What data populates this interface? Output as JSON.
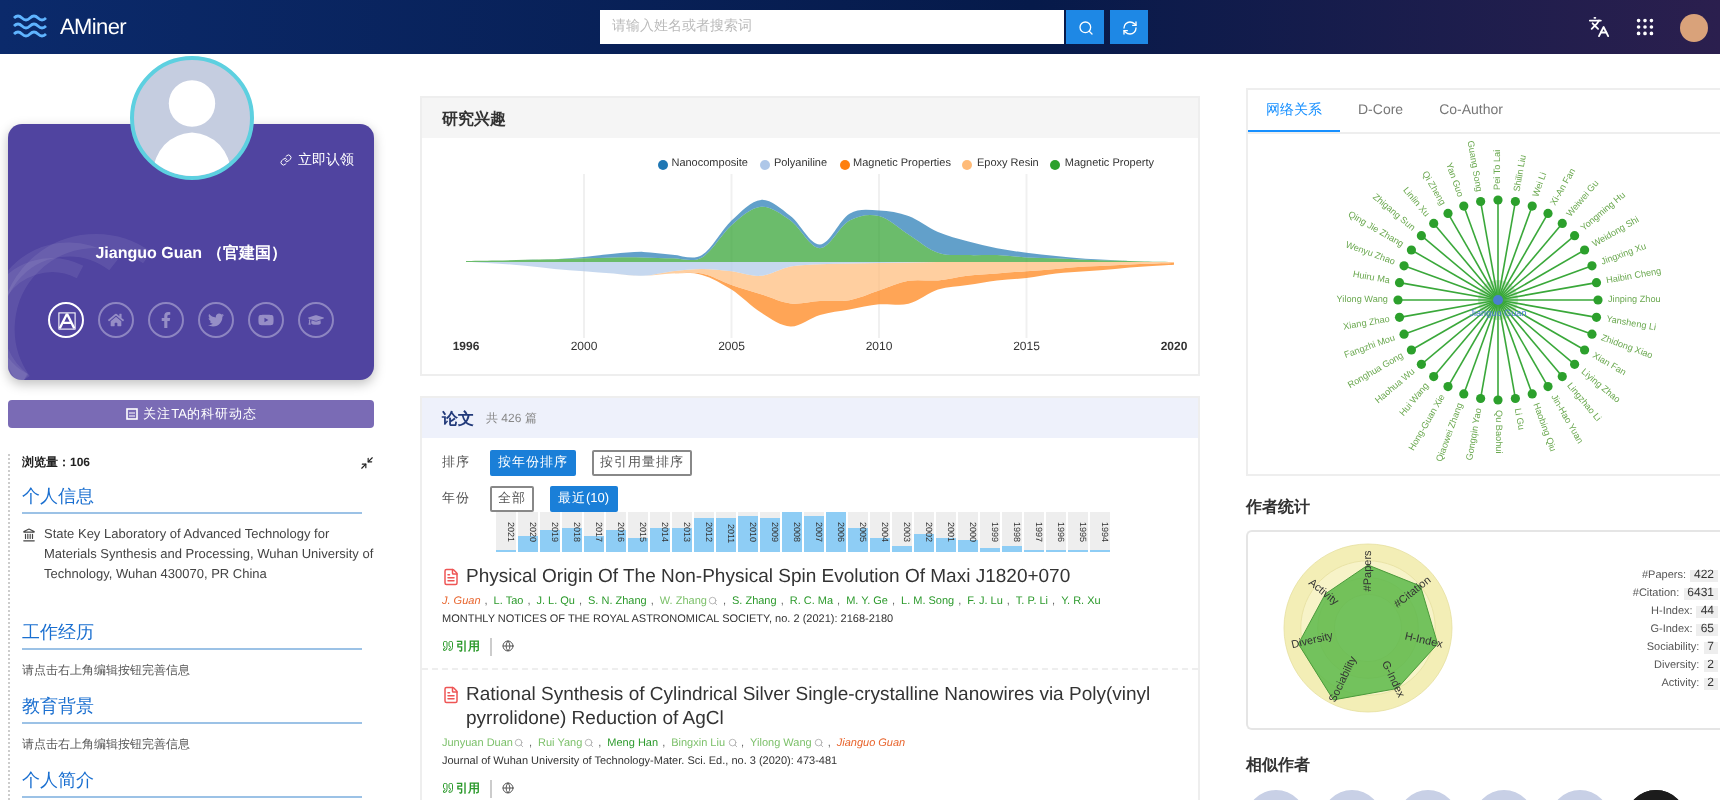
{
  "topbar": {
    "logo": "AMiner",
    "search": {
      "placeholder": "请输入姓名或者搜索词"
    }
  },
  "profile": {
    "claim": "立即认领",
    "name": "Jianguo Guan （官建国）",
    "social_links": [
      {
        "kind": "aminer",
        "selected": true
      },
      {
        "kind": "home",
        "selected": false
      },
      {
        "kind": "facebook",
        "selected": false
      },
      {
        "kind": "twitter",
        "selected": false
      },
      {
        "kind": "youtube",
        "selected": false
      },
      {
        "kind": "scholar",
        "selected": false
      }
    ],
    "follow_button": "关注TA的科研动态",
    "views": "浏览量：106",
    "sections": [
      {
        "title": "个人信息",
        "kind": "institution",
        "text": "State Key Laboratory of Advanced Technology for Materials Synthesis and Processing, Wuhan University of Technology, Wuhan 430070, PR China"
      },
      {
        "title": "工作经历",
        "kind": "hint",
        "text": "请点击右上角编辑按钮完善信息"
      },
      {
        "title": "教育背景",
        "kind": "hint",
        "text": "请点击右上角编辑按钮完善信息"
      },
      {
        "title": "个人简介",
        "kind": "empty"
      }
    ]
  },
  "interests": {
    "title": "研究兴趣",
    "legend": [
      {
        "label": "Nanocomposite",
        "color": "#1f77b4"
      },
      {
        "label": "Polyaniline",
        "color": "#aec7e8"
      },
      {
        "label": "Magnetic Properties",
        "color": "#ff7f0e"
      },
      {
        "label": "Epoxy Resin",
        "color": "#ffbb78"
      },
      {
        "label": "Magnetic Property",
        "color": "#2ca02c"
      }
    ],
    "axis": [
      "1996",
      "2000",
      "2005",
      "2010",
      "2015",
      "2020"
    ]
  },
  "papers": {
    "title": "论文",
    "count": "共 426 篇",
    "sort_label": "排序",
    "sort_options": [
      {
        "label": "按年份排序",
        "selected": true
      },
      {
        "label": "按引用量排序",
        "selected": false
      }
    ],
    "year_label": "年份",
    "year_options": [
      {
        "label": "全部",
        "selected": false
      },
      {
        "label": "最近(10)",
        "selected": true
      }
    ],
    "years": [
      {
        "year": "2021",
        "level": 0.05
      },
      {
        "year": "2020",
        "level": 0.4
      },
      {
        "year": "2019",
        "level": 0.55
      },
      {
        "year": "2018",
        "level": 0.6
      },
      {
        "year": "2017",
        "level": 0.4
      },
      {
        "year": "2016",
        "level": 0.55
      },
      {
        "year": "2015",
        "level": 0.35
      },
      {
        "year": "2014",
        "level": 0.6
      },
      {
        "year": "2013",
        "level": 0.6
      },
      {
        "year": "2012",
        "level": 0.85
      },
      {
        "year": "2011",
        "level": 0.85
      },
      {
        "year": "2010",
        "level": 0.9
      },
      {
        "year": "2009",
        "level": 0.85
      },
      {
        "year": "2008",
        "level": 1.0
      },
      {
        "year": "2007",
        "level": 0.9
      },
      {
        "year": "2006",
        "level": 1.0
      },
      {
        "year": "2005",
        "level": 0.6
      },
      {
        "year": "2004",
        "level": 0.35
      },
      {
        "year": "2003",
        "level": 0.15
      },
      {
        "year": "2002",
        "level": 0.45
      },
      {
        "year": "2001",
        "level": 0.35
      },
      {
        "year": "2000",
        "level": 0.3
      },
      {
        "year": "1999",
        "level": 0.1
      },
      {
        "year": "1998",
        "level": 0.15
      },
      {
        "year": "1997",
        "level": 0.07
      },
      {
        "year": "1996",
        "level": 0.05
      },
      {
        "year": "1995",
        "level": 0.04
      },
      {
        "year": "1994",
        "level": 0.03
      }
    ],
    "items": [
      {
        "title": "Physical Origin Of The Non-Physical Spin Evolution Of Maxi J1820+070",
        "authors": [
          {
            "name": "J. Guan",
            "kind": "self"
          },
          {
            "name": "L. Tao",
            "kind": "linked"
          },
          {
            "name": "J. L. Qu",
            "kind": "linked"
          },
          {
            "name": "S. N. Zhang",
            "kind": "linked"
          },
          {
            "name": "W. Zhang",
            "kind": "unmatched"
          },
          {
            "name": "S. Zhang",
            "kind": "linked"
          },
          {
            "name": "R. C. Ma",
            "kind": "linked"
          },
          {
            "name": "M. Y. Ge",
            "kind": "linked"
          },
          {
            "name": "L. M. Song",
            "kind": "linked"
          },
          {
            "name": "F. J. Lu",
            "kind": "linked"
          },
          {
            "name": "T. P. Li",
            "kind": "linked"
          },
          {
            "name": "Y. R. Xu",
            "kind": "linked"
          }
        ],
        "separator": ",",
        "venue": "MONTHLY NOTICES OF THE ROYAL ASTRONOMICAL SOCIETY, no. 2 (2021): 2168-2180",
        "cite": "引用"
      },
      {
        "title": "Rational Synthesis of Cylindrical Silver Single-crystalline Nanowires via Poly(vinyl pyrrolidone) Reduction of AgCl",
        "authors": [
          {
            "name": "Junyuan Duan",
            "kind": "unmatched"
          },
          {
            "name": "Rui Yang",
            "kind": "unmatched"
          },
          {
            "name": "Meng Han",
            "kind": "linked"
          },
          {
            "name": "Bingxin Liu",
            "kind": "unmatched"
          },
          {
            "name": "Yilong Wang",
            "kind": "unmatched"
          },
          {
            "name": "Jianguo Guan",
            "kind": "self"
          }
        ],
        "separator": ",",
        "venue": "Journal of Wuhan University of Technology-Mater. Sci. Ed., no. 3 (2020): 473-481",
        "cite": "引用"
      }
    ]
  },
  "network": {
    "tabs": [
      {
        "label": "网络关系",
        "selected": true
      },
      {
        "label": "D-Core",
        "selected": false
      },
      {
        "label": "Co-Author",
        "selected": false
      }
    ],
    "center": "Jianguo Guan",
    "coauthors": [
      "Yilong Wang",
      "Huiru Ma",
      "Wenyu Zhao",
      "Qing Jie Zhang",
      "Zhigang Sun",
      "Linlin Xu",
      "Qi Zheng",
      "Yan Guo",
      "Guang Song",
      "Pei To Lai",
      "Shilin Liu",
      "Wei Li",
      "Xi-An Fan",
      "Weiwei Gu",
      "Yongming Hu",
      "Weidong Shi",
      "Jingxing Xu",
      "Haibin Cheng",
      "Jinping Zhou",
      "Yansheng Li",
      "Zhidong Xiao",
      "Xian Fan",
      "Liying Zhao",
      "Lingzhao Li",
      "Jin-Hao Yuan",
      "Haobing Qiu",
      "Li Gu",
      "Qu Baohui",
      "Gongqin Yao",
      "Qiaowei Zhang",
      "Hong-Guan Xie",
      "Hui Wang",
      "Haohua Wu",
      "Ronghua Gong",
      "Fangzhi Mou",
      "Xiang Zhao"
    ]
  },
  "stats": {
    "title": "作者统计",
    "radar_axes": [
      "#Papers",
      "#Citation",
      "H-Index",
      "G-Index",
      "Sociability",
      "Diversity",
      "Activity"
    ],
    "rows": [
      {
        "label": "#Papers:",
        "value": "422"
      },
      {
        "label": "#Citation:",
        "value": "6431"
      },
      {
        "label": "H-Index:",
        "value": "44"
      },
      {
        "label": "G-Index:",
        "value": "65"
      },
      {
        "label": "Sociability:",
        "value": "7"
      },
      {
        "label": "Diversity:",
        "value": "2"
      },
      {
        "label": "Activity:",
        "value": "2"
      }
    ]
  },
  "similar": {
    "title": "相似作者",
    "authors": [
      {
        "kind": "placeholder"
      },
      {
        "kind": "placeholder"
      },
      {
        "kind": "placeholder"
      },
      {
        "kind": "placeholder"
      },
      {
        "kind": "placeholder"
      },
      {
        "kind": "picture"
      }
    ]
  }
}
